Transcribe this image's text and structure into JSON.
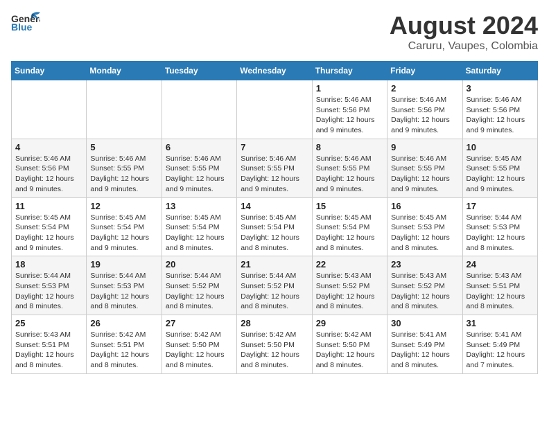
{
  "header": {
    "logo_line1": "General",
    "logo_line2": "Blue",
    "title": "August 2024",
    "subtitle": "Caruru, Vaupes, Colombia"
  },
  "weekdays": [
    "Sunday",
    "Monday",
    "Tuesday",
    "Wednesday",
    "Thursday",
    "Friday",
    "Saturday"
  ],
  "weeks": [
    [
      {
        "day": "",
        "info": ""
      },
      {
        "day": "",
        "info": ""
      },
      {
        "day": "",
        "info": ""
      },
      {
        "day": "",
        "info": ""
      },
      {
        "day": "1",
        "info": "Sunrise: 5:46 AM\nSunset: 5:56 PM\nDaylight: 12 hours\nand 9 minutes."
      },
      {
        "day": "2",
        "info": "Sunrise: 5:46 AM\nSunset: 5:56 PM\nDaylight: 12 hours\nand 9 minutes."
      },
      {
        "day": "3",
        "info": "Sunrise: 5:46 AM\nSunset: 5:56 PM\nDaylight: 12 hours\nand 9 minutes."
      }
    ],
    [
      {
        "day": "4",
        "info": "Sunrise: 5:46 AM\nSunset: 5:56 PM\nDaylight: 12 hours\nand 9 minutes."
      },
      {
        "day": "5",
        "info": "Sunrise: 5:46 AM\nSunset: 5:55 PM\nDaylight: 12 hours\nand 9 minutes."
      },
      {
        "day": "6",
        "info": "Sunrise: 5:46 AM\nSunset: 5:55 PM\nDaylight: 12 hours\nand 9 minutes."
      },
      {
        "day": "7",
        "info": "Sunrise: 5:46 AM\nSunset: 5:55 PM\nDaylight: 12 hours\nand 9 minutes."
      },
      {
        "day": "8",
        "info": "Sunrise: 5:46 AM\nSunset: 5:55 PM\nDaylight: 12 hours\nand 9 minutes."
      },
      {
        "day": "9",
        "info": "Sunrise: 5:46 AM\nSunset: 5:55 PM\nDaylight: 12 hours\nand 9 minutes."
      },
      {
        "day": "10",
        "info": "Sunrise: 5:45 AM\nSunset: 5:55 PM\nDaylight: 12 hours\nand 9 minutes."
      }
    ],
    [
      {
        "day": "11",
        "info": "Sunrise: 5:45 AM\nSunset: 5:54 PM\nDaylight: 12 hours\nand 9 minutes."
      },
      {
        "day": "12",
        "info": "Sunrise: 5:45 AM\nSunset: 5:54 PM\nDaylight: 12 hours\nand 9 minutes."
      },
      {
        "day": "13",
        "info": "Sunrise: 5:45 AM\nSunset: 5:54 PM\nDaylight: 12 hours\nand 8 minutes."
      },
      {
        "day": "14",
        "info": "Sunrise: 5:45 AM\nSunset: 5:54 PM\nDaylight: 12 hours\nand 8 minutes."
      },
      {
        "day": "15",
        "info": "Sunrise: 5:45 AM\nSunset: 5:54 PM\nDaylight: 12 hours\nand 8 minutes."
      },
      {
        "day": "16",
        "info": "Sunrise: 5:45 AM\nSunset: 5:53 PM\nDaylight: 12 hours\nand 8 minutes."
      },
      {
        "day": "17",
        "info": "Sunrise: 5:44 AM\nSunset: 5:53 PM\nDaylight: 12 hours\nand 8 minutes."
      }
    ],
    [
      {
        "day": "18",
        "info": "Sunrise: 5:44 AM\nSunset: 5:53 PM\nDaylight: 12 hours\nand 8 minutes."
      },
      {
        "day": "19",
        "info": "Sunrise: 5:44 AM\nSunset: 5:53 PM\nDaylight: 12 hours\nand 8 minutes."
      },
      {
        "day": "20",
        "info": "Sunrise: 5:44 AM\nSunset: 5:52 PM\nDaylight: 12 hours\nand 8 minutes."
      },
      {
        "day": "21",
        "info": "Sunrise: 5:44 AM\nSunset: 5:52 PM\nDaylight: 12 hours\nand 8 minutes."
      },
      {
        "day": "22",
        "info": "Sunrise: 5:43 AM\nSunset: 5:52 PM\nDaylight: 12 hours\nand 8 minutes."
      },
      {
        "day": "23",
        "info": "Sunrise: 5:43 AM\nSunset: 5:52 PM\nDaylight: 12 hours\nand 8 minutes."
      },
      {
        "day": "24",
        "info": "Sunrise: 5:43 AM\nSunset: 5:51 PM\nDaylight: 12 hours\nand 8 minutes."
      }
    ],
    [
      {
        "day": "25",
        "info": "Sunrise: 5:43 AM\nSunset: 5:51 PM\nDaylight: 12 hours\nand 8 minutes."
      },
      {
        "day": "26",
        "info": "Sunrise: 5:42 AM\nSunset: 5:51 PM\nDaylight: 12 hours\nand 8 minutes."
      },
      {
        "day": "27",
        "info": "Sunrise: 5:42 AM\nSunset: 5:50 PM\nDaylight: 12 hours\nand 8 minutes."
      },
      {
        "day": "28",
        "info": "Sunrise: 5:42 AM\nSunset: 5:50 PM\nDaylight: 12 hours\nand 8 minutes."
      },
      {
        "day": "29",
        "info": "Sunrise: 5:42 AM\nSunset: 5:50 PM\nDaylight: 12 hours\nand 8 minutes."
      },
      {
        "day": "30",
        "info": "Sunrise: 5:41 AM\nSunset: 5:49 PM\nDaylight: 12 hours\nand 8 minutes."
      },
      {
        "day": "31",
        "info": "Sunrise: 5:41 AM\nSunset: 5:49 PM\nDaylight: 12 hours\nand 7 minutes."
      }
    ]
  ]
}
